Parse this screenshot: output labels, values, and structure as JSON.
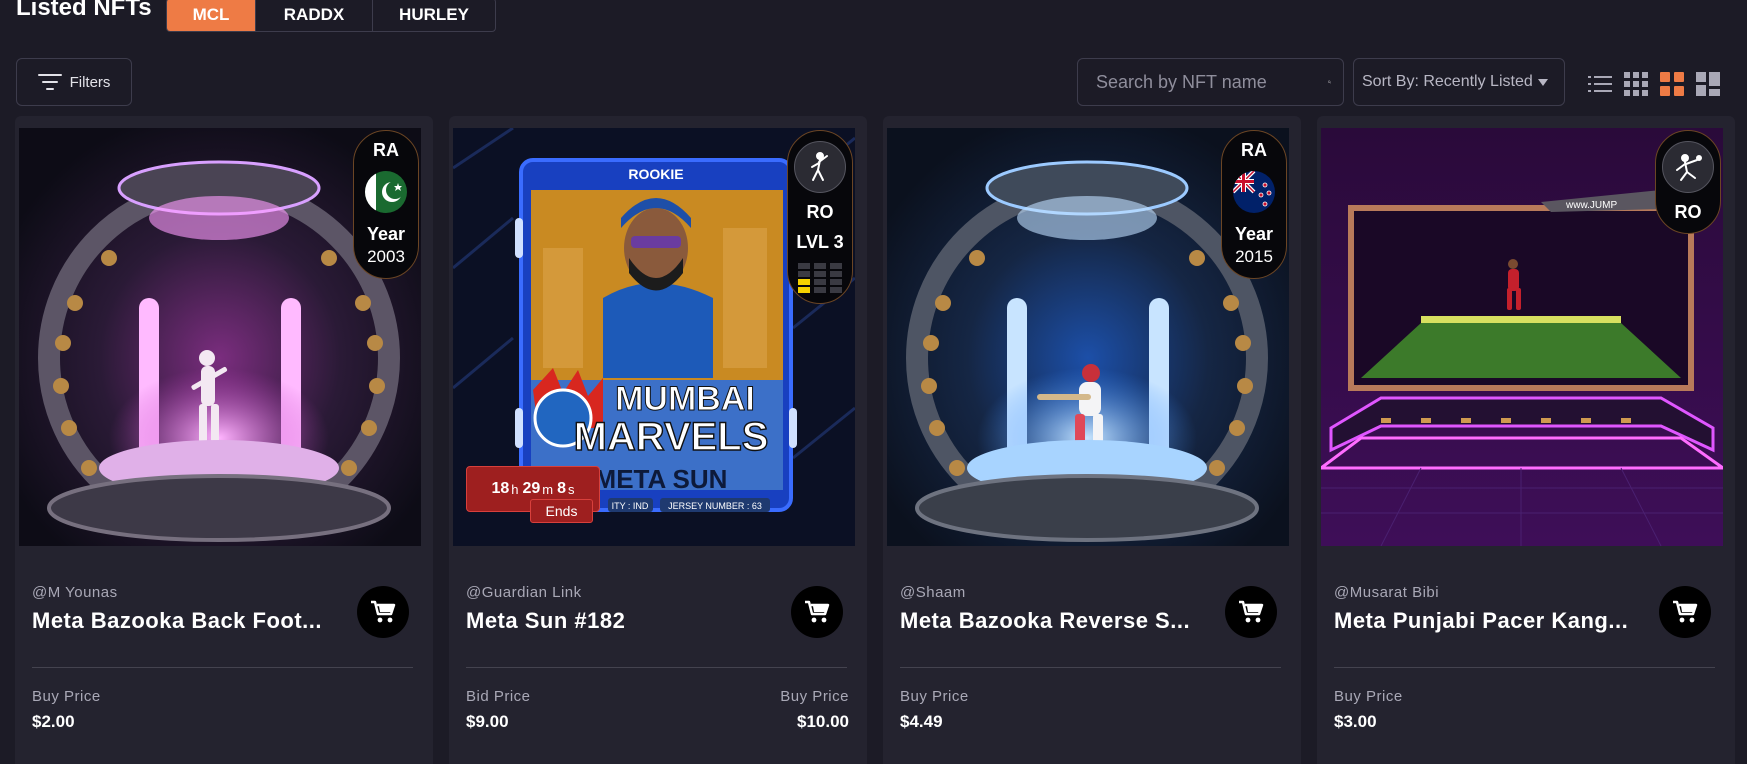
{
  "page": {
    "title": "Listed NFTs"
  },
  "tabs": [
    {
      "label": "MCL",
      "active": true
    },
    {
      "label": "RADDX",
      "active": false
    },
    {
      "label": "HURLEY",
      "active": false
    }
  ],
  "toolbar": {
    "filters_label": "Filters",
    "search_placeholder": "Search by NFT name",
    "sort_label": "Sort By: Recently Listed"
  },
  "colors": {
    "accent": "#ee7b45",
    "timer": "#9e1f1f",
    "card": "#24232f",
    "background": "#1c1b26"
  },
  "cards": [
    {
      "owner": "@M Younas",
      "name": "Meta Bazooka Back Foot...",
      "badge": {
        "tier": "RA",
        "flag": "pakistan-flag",
        "year_label": "Year",
        "year": "2003"
      },
      "price_left": {
        "label": "Buy Price",
        "value": "$2.00"
      }
    },
    {
      "owner": "@Guardian Link",
      "name": "Meta Sun #182",
      "badge": {
        "role_icon": "bowler-icon",
        "tier": "RO",
        "level": "LVL 3"
      },
      "timer": {
        "h": "18",
        "m": "29",
        "s": "8",
        "ends": "Ends"
      },
      "card_art": {
        "rookie": "ROOKIE",
        "team_line1": "MUMBAI",
        "team_line2": "MARVELS",
        "player": "META SUN",
        "country": "ITY : IND",
        "jersey": "JERSEY NUMBER : 63"
      },
      "price_left": {
        "label": "Bid Price",
        "value": "$9.00"
      },
      "price_right": {
        "label": "Buy Price",
        "value": "$10.00"
      }
    },
    {
      "owner": "@Shaam",
      "name": "Meta Bazooka Reverse S...",
      "badge": {
        "tier": "RA",
        "flag": "new-zealand-flag",
        "year_label": "Year",
        "year": "2015"
      },
      "price_left": {
        "label": "Buy Price",
        "value": "$4.49"
      }
    },
    {
      "owner": "@Musarat Bibi",
      "name": "Meta Punjabi Pacer Kang...",
      "badge": {
        "role_icon": "fielder-icon",
        "tier": "RO"
      },
      "art_text": "www.JUMP",
      "price_left": {
        "label": "Buy Price",
        "value": "$3.00"
      }
    }
  ]
}
